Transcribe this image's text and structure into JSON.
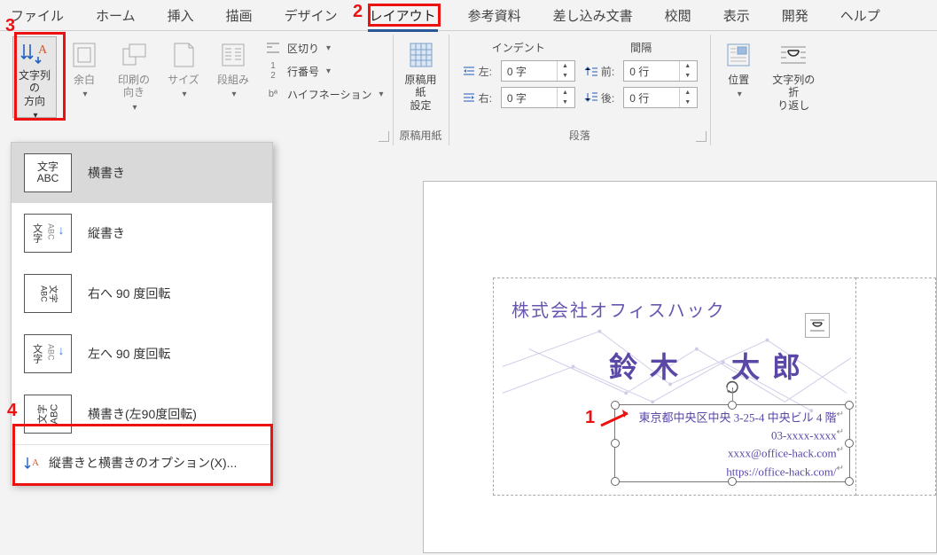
{
  "tabs": {
    "file": "ファイル",
    "home": "ホーム",
    "insert": "挿入",
    "draw": "描画",
    "design": "デザイン",
    "layout": "レイアウト",
    "references": "参考資料",
    "mailings": "差し込み文書",
    "review": "校閲",
    "view": "表示",
    "developer": "開発",
    "help": "ヘルプ"
  },
  "ribbon": {
    "pageSetup": {
      "text_direction": "文字列の\n方向",
      "margins": "余白",
      "orientation": "印刷の\n向き",
      "size": "サイズ",
      "columns": "段組み",
      "breaks": "区切り",
      "line_numbers": "行番号",
      "hyphenation": "ハイフネーション"
    },
    "manuscript": {
      "button": "原稿用紙\n設定",
      "group": "原稿用紙"
    },
    "paragraph": {
      "indent_header": "インデント",
      "spacing_header": "間隔",
      "left_label": "左:",
      "right_label": "右:",
      "before_label": "前:",
      "after_label": "後:",
      "left_value": "0 字",
      "right_value": "0 字",
      "before_value": "0 行",
      "after_value": "0 行",
      "group": "段落"
    },
    "arrange": {
      "position": "位置",
      "wrap": "文字列の折\nり返し"
    }
  },
  "dropdown": {
    "horizontal": "横書き",
    "vertical": "縦書き",
    "rotate_right": "右へ 90 度回転",
    "rotate_left": "左へ 90 度回転",
    "horizontal_l90": "横書き(左90度回転)",
    "options": "縦書きと横書きのオプション(X)...",
    "thumb_horizontal": "文字\nABC",
    "thumb_vertical": "文字",
    "thumb_rr": "文字",
    "thumb_rl": "文字",
    "thumb_hl90": "文字\nABC"
  },
  "card": {
    "company": "株式会社オフィスハック",
    "name": "鈴木　太郎",
    "addr": "東京都中央区中央 3-25-4  中央ビル 4 階",
    "tel": "03-xxxx-xxxx",
    "email": "xxxx@office-hack.com",
    "url": "https://office-hack.com/"
  },
  "anno": {
    "n1": "1",
    "n2": "2",
    "n3": "3",
    "n4": "4"
  }
}
